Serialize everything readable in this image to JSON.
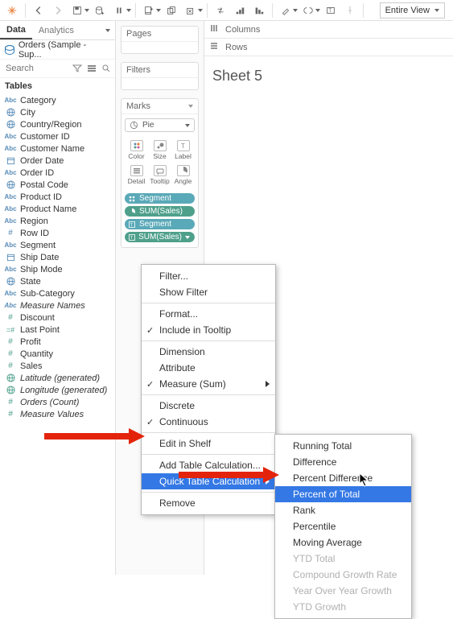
{
  "toolbar": {
    "view_mode": "Entire View"
  },
  "side": {
    "tabs": {
      "data": "Data",
      "analytics": "Analytics"
    },
    "datasource": "Orders (Sample - Sup...",
    "search_placeholder": "Search",
    "tables_header": "Tables",
    "fields": [
      {
        "icon": "Abc",
        "label": "Category",
        "type": "dim"
      },
      {
        "icon": "globe",
        "label": "City",
        "type": "dim"
      },
      {
        "icon": "globe",
        "label": "Country/Region",
        "type": "dim"
      },
      {
        "icon": "Abc",
        "label": "Customer ID",
        "type": "dim"
      },
      {
        "icon": "Abc",
        "label": "Customer Name",
        "type": "dim"
      },
      {
        "icon": "date",
        "label": "Order Date",
        "type": "dim"
      },
      {
        "icon": "Abc",
        "label": "Order ID",
        "type": "dim"
      },
      {
        "icon": "globe",
        "label": "Postal Code",
        "type": "dim"
      },
      {
        "icon": "Abc",
        "label": "Product ID",
        "type": "dim"
      },
      {
        "icon": "Abc",
        "label": "Product Name",
        "type": "dim"
      },
      {
        "icon": "Abc",
        "label": "Region",
        "type": "dim"
      },
      {
        "icon": "#",
        "label": "Row ID",
        "type": "dim"
      },
      {
        "icon": "Abc",
        "label": "Segment",
        "type": "dim"
      },
      {
        "icon": "date",
        "label": "Ship Date",
        "type": "dim"
      },
      {
        "icon": "Abc",
        "label": "Ship Mode",
        "type": "dim"
      },
      {
        "icon": "globe",
        "label": "State",
        "type": "dim"
      },
      {
        "icon": "Abc",
        "label": "Sub-Category",
        "type": "dim"
      },
      {
        "icon": "Abc",
        "label": "Measure Names",
        "type": "dim",
        "italic": true
      },
      {
        "icon": "#",
        "label": "Discount",
        "type": "mea"
      },
      {
        "icon": "=#",
        "label": "Last Point",
        "type": "mea"
      },
      {
        "icon": "#",
        "label": "Profit",
        "type": "mea"
      },
      {
        "icon": "#",
        "label": "Quantity",
        "type": "mea"
      },
      {
        "icon": "#",
        "label": "Sales",
        "type": "mea"
      },
      {
        "icon": "globe",
        "label": "Latitude (generated)",
        "type": "mea",
        "italic": true
      },
      {
        "icon": "globe",
        "label": "Longitude (generated)",
        "type": "mea",
        "italic": true
      },
      {
        "icon": "#",
        "label": "Orders (Count)",
        "type": "mea",
        "italic": true
      },
      {
        "icon": "#",
        "label": "Measure Values",
        "type": "mea",
        "italic": true
      }
    ]
  },
  "shelves": {
    "pages": "Pages",
    "filters": "Filters",
    "marks": "Marks"
  },
  "marks": {
    "type": "Pie",
    "cells": [
      {
        "label": "Color"
      },
      {
        "label": "Size"
      },
      {
        "label": "Label"
      },
      {
        "label": "Detail"
      },
      {
        "label": "Tooltip"
      },
      {
        "label": "Angle"
      }
    ],
    "pills": [
      {
        "kind": "dim",
        "icon": "color",
        "text": "Segment"
      },
      {
        "kind": "mea",
        "icon": "angle",
        "text": "SUM(Sales)"
      },
      {
        "kind": "dim",
        "icon": "label",
        "text": "Segment"
      },
      {
        "kind": "mea",
        "icon": "label",
        "text": "SUM(Sales)",
        "active": true
      }
    ]
  },
  "rowscols": {
    "columns": "Columns",
    "rows": "Rows"
  },
  "sheet": {
    "name": "Sheet 5"
  },
  "context_menu": {
    "items": [
      {
        "label": "Filter..."
      },
      {
        "label": "Show Filter"
      },
      {
        "sep": true
      },
      {
        "label": "Format..."
      },
      {
        "label": "Include in Tooltip",
        "checked": true
      },
      {
        "sep": true
      },
      {
        "label": "Dimension"
      },
      {
        "label": "Attribute"
      },
      {
        "label": "Measure (Sum)",
        "checked": true,
        "submenu": true
      },
      {
        "sep": true
      },
      {
        "label": "Discrete"
      },
      {
        "label": "Continuous",
        "checked": true
      },
      {
        "sep": true
      },
      {
        "label": "Edit in Shelf"
      },
      {
        "sep": true
      },
      {
        "label": "Add Table Calculation..."
      },
      {
        "label": "Quick Table Calculation",
        "submenu": true,
        "highlight": true
      },
      {
        "sep": true
      },
      {
        "label": "Remove"
      }
    ]
  },
  "sub_menu": {
    "items": [
      {
        "label": "Running Total"
      },
      {
        "label": "Difference"
      },
      {
        "label": "Percent Difference"
      },
      {
        "label": "Percent of Total",
        "highlight": true
      },
      {
        "label": "Rank"
      },
      {
        "label": "Percentile"
      },
      {
        "label": "Moving Average"
      },
      {
        "label": "YTD Total",
        "disabled": true
      },
      {
        "label": "Compound Growth Rate",
        "disabled": true
      },
      {
        "label": "Year Over Year Growth",
        "disabled": true
      },
      {
        "label": "YTD Growth",
        "disabled": true
      }
    ]
  }
}
